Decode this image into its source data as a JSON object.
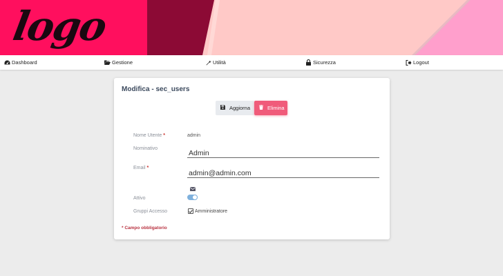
{
  "header": {
    "logo_text": "logo",
    "colors": {
      "magenta": "#ff0f5e",
      "maroon": "#8c0a35",
      "blush": "#ffc9c7",
      "pink": "#ff9fcc"
    }
  },
  "nav": {
    "dashboard": "Dashboard",
    "gestione": "Gestione",
    "utilita": "Utilità",
    "sicurezza": "Sicurezza",
    "logout": "Logout"
  },
  "form": {
    "title": "Modifica - sec_users",
    "update_label": "Aggiorna",
    "delete_label": "Elimina",
    "username_label": "Nome Utente",
    "username_value": "admin",
    "name_label": "Nominativo",
    "name_value": "Admin",
    "email_label": "Email",
    "email_value": "admin@admin.com",
    "active_label": "Attivo",
    "active_on": true,
    "groups_label": "Gruppi Accesso",
    "group_option": "Amministratore",
    "group_checked": true,
    "required_marker": "*",
    "required_note": "* Campo obbligatorio"
  }
}
